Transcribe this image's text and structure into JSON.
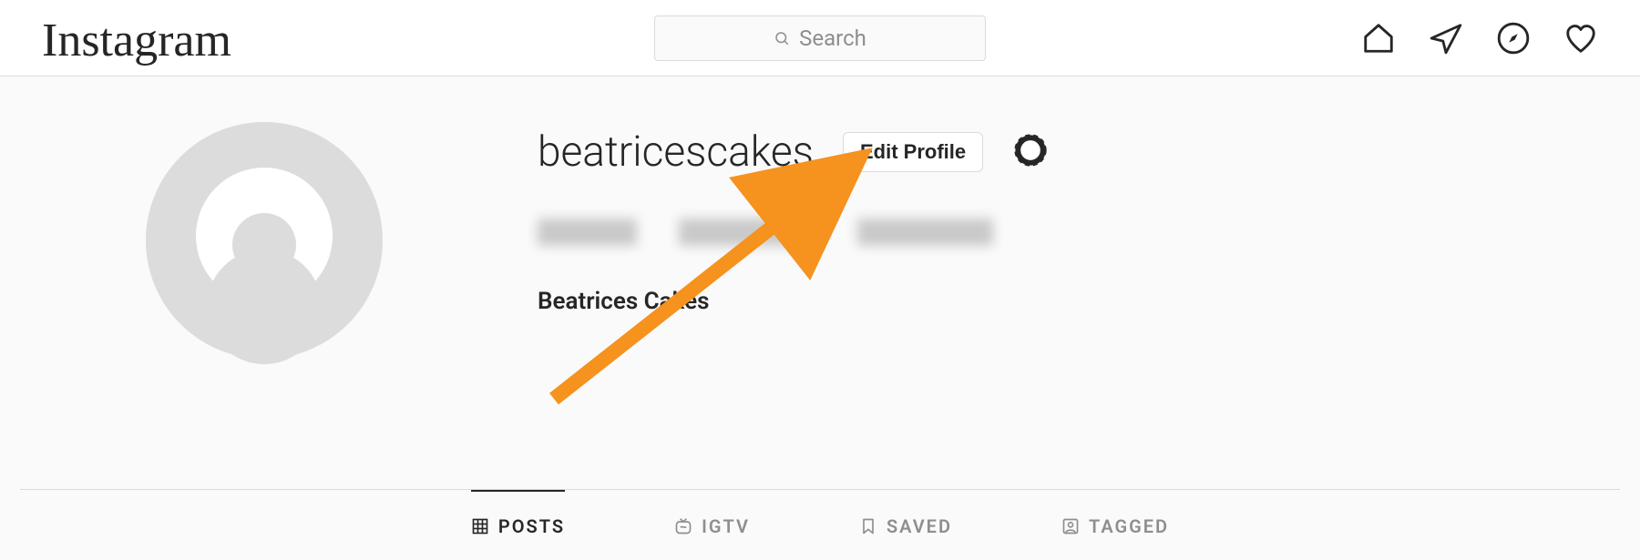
{
  "nav": {
    "logo_text": "Instagram",
    "search_placeholder": "Search"
  },
  "profile": {
    "username": "beatricescakes",
    "edit_label": "Edit Profile",
    "display_name": "Beatrices Cakes"
  },
  "tabs": {
    "posts": "POSTS",
    "igtv": "IGTV",
    "saved": "SAVED",
    "tagged": "TAGGED"
  },
  "colors": {
    "arrow": "#f6921e"
  }
}
